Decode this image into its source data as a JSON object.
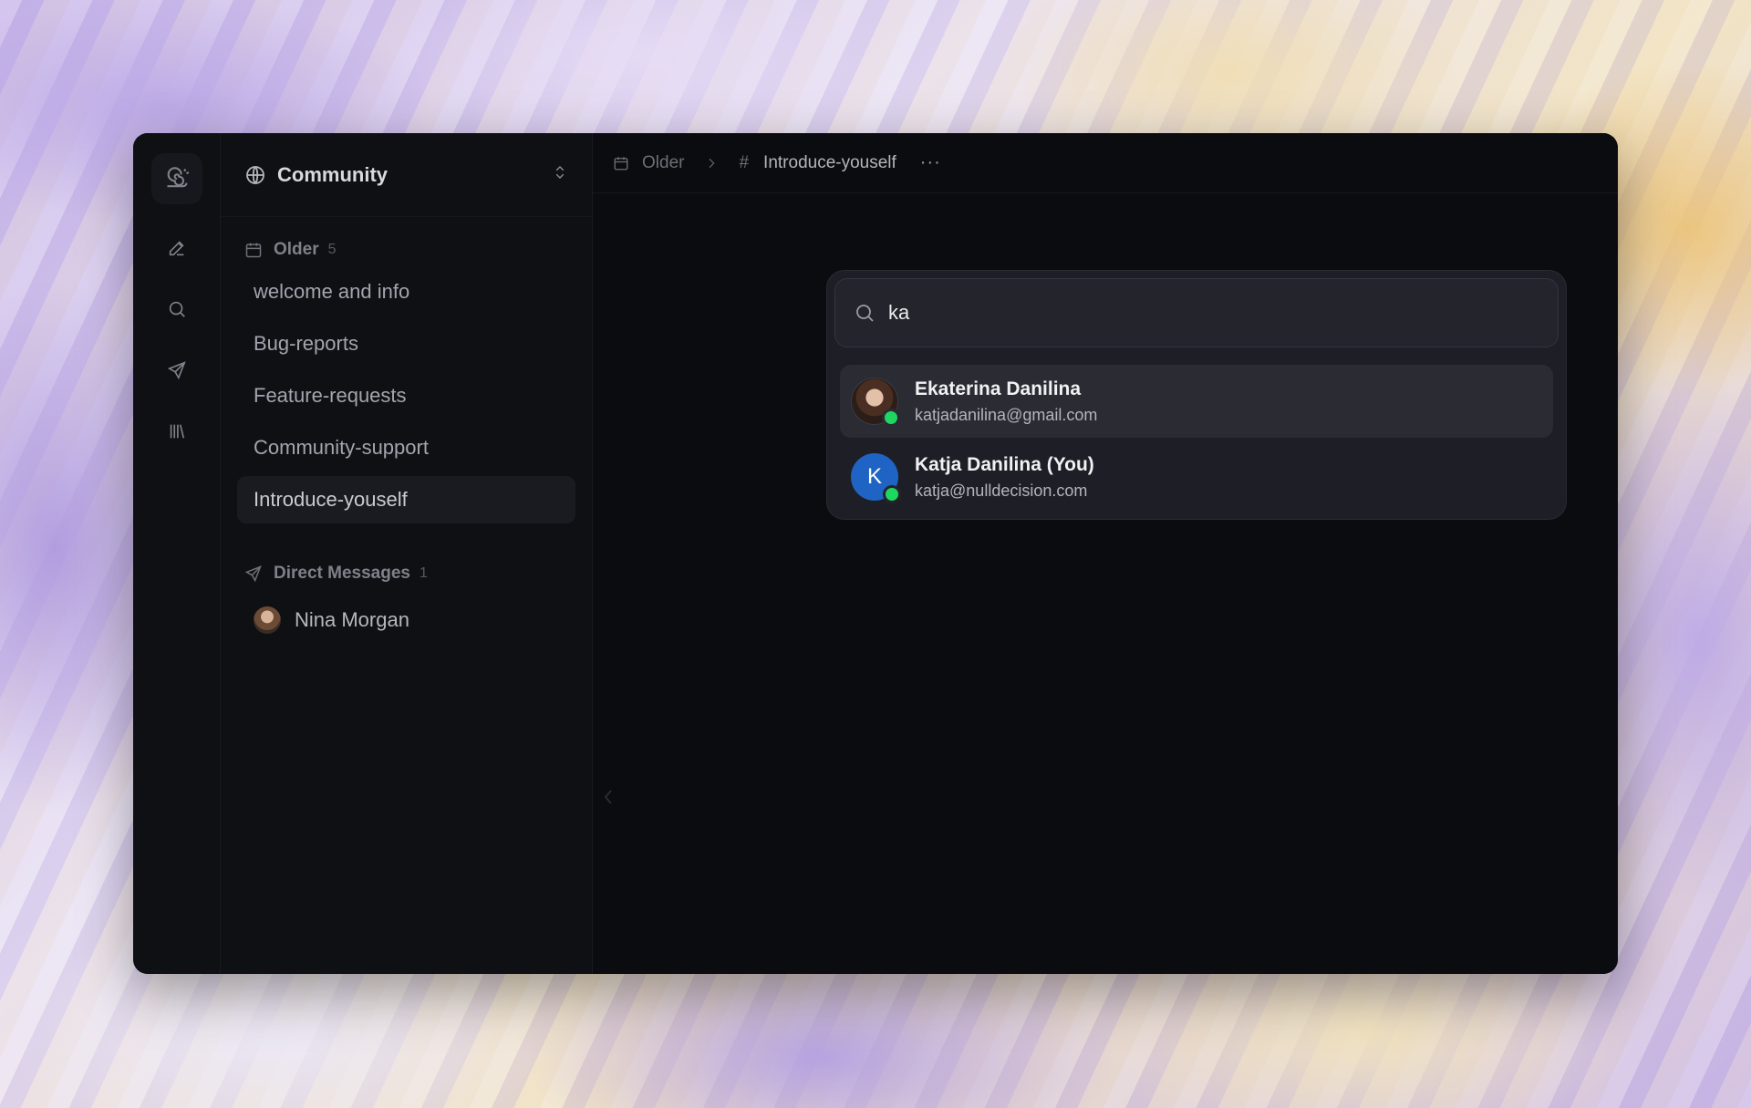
{
  "rail": {
    "icons": [
      "snail-logo-icon",
      "compose-icon",
      "search-icon",
      "send-icon",
      "library-icon"
    ]
  },
  "workspace": {
    "name": "Community"
  },
  "channels_section": {
    "title": "Older",
    "count": "5",
    "items": [
      {
        "label": "welcome and info",
        "active": false
      },
      {
        "label": "Bug-reports",
        "active": false
      },
      {
        "label": "Feature-requests",
        "active": false
      },
      {
        "label": "Community-support",
        "active": false
      },
      {
        "label": "Introduce-youself",
        "active": true
      }
    ]
  },
  "dm_section": {
    "title": "Direct Messages",
    "count": "1",
    "items": [
      {
        "label": "Nina Morgan"
      }
    ]
  },
  "breadcrumb": {
    "older": "Older",
    "hash": "#",
    "channel": "Introduce-youself",
    "more": "···"
  },
  "search": {
    "value": "ka",
    "placeholder": ""
  },
  "results": [
    {
      "name": "Ekaterina Danilina",
      "email": "katjadanilina@gmail.com",
      "avatar": "photo",
      "online": true
    },
    {
      "name": "Katja Danilina (You)",
      "email": "katja@nulldecision.com",
      "avatar": "K",
      "online": true
    }
  ],
  "colors": {
    "window_bg": "#0c0d10",
    "presence_online": "#1ed760",
    "avatar_blue": "#1f64c4"
  }
}
